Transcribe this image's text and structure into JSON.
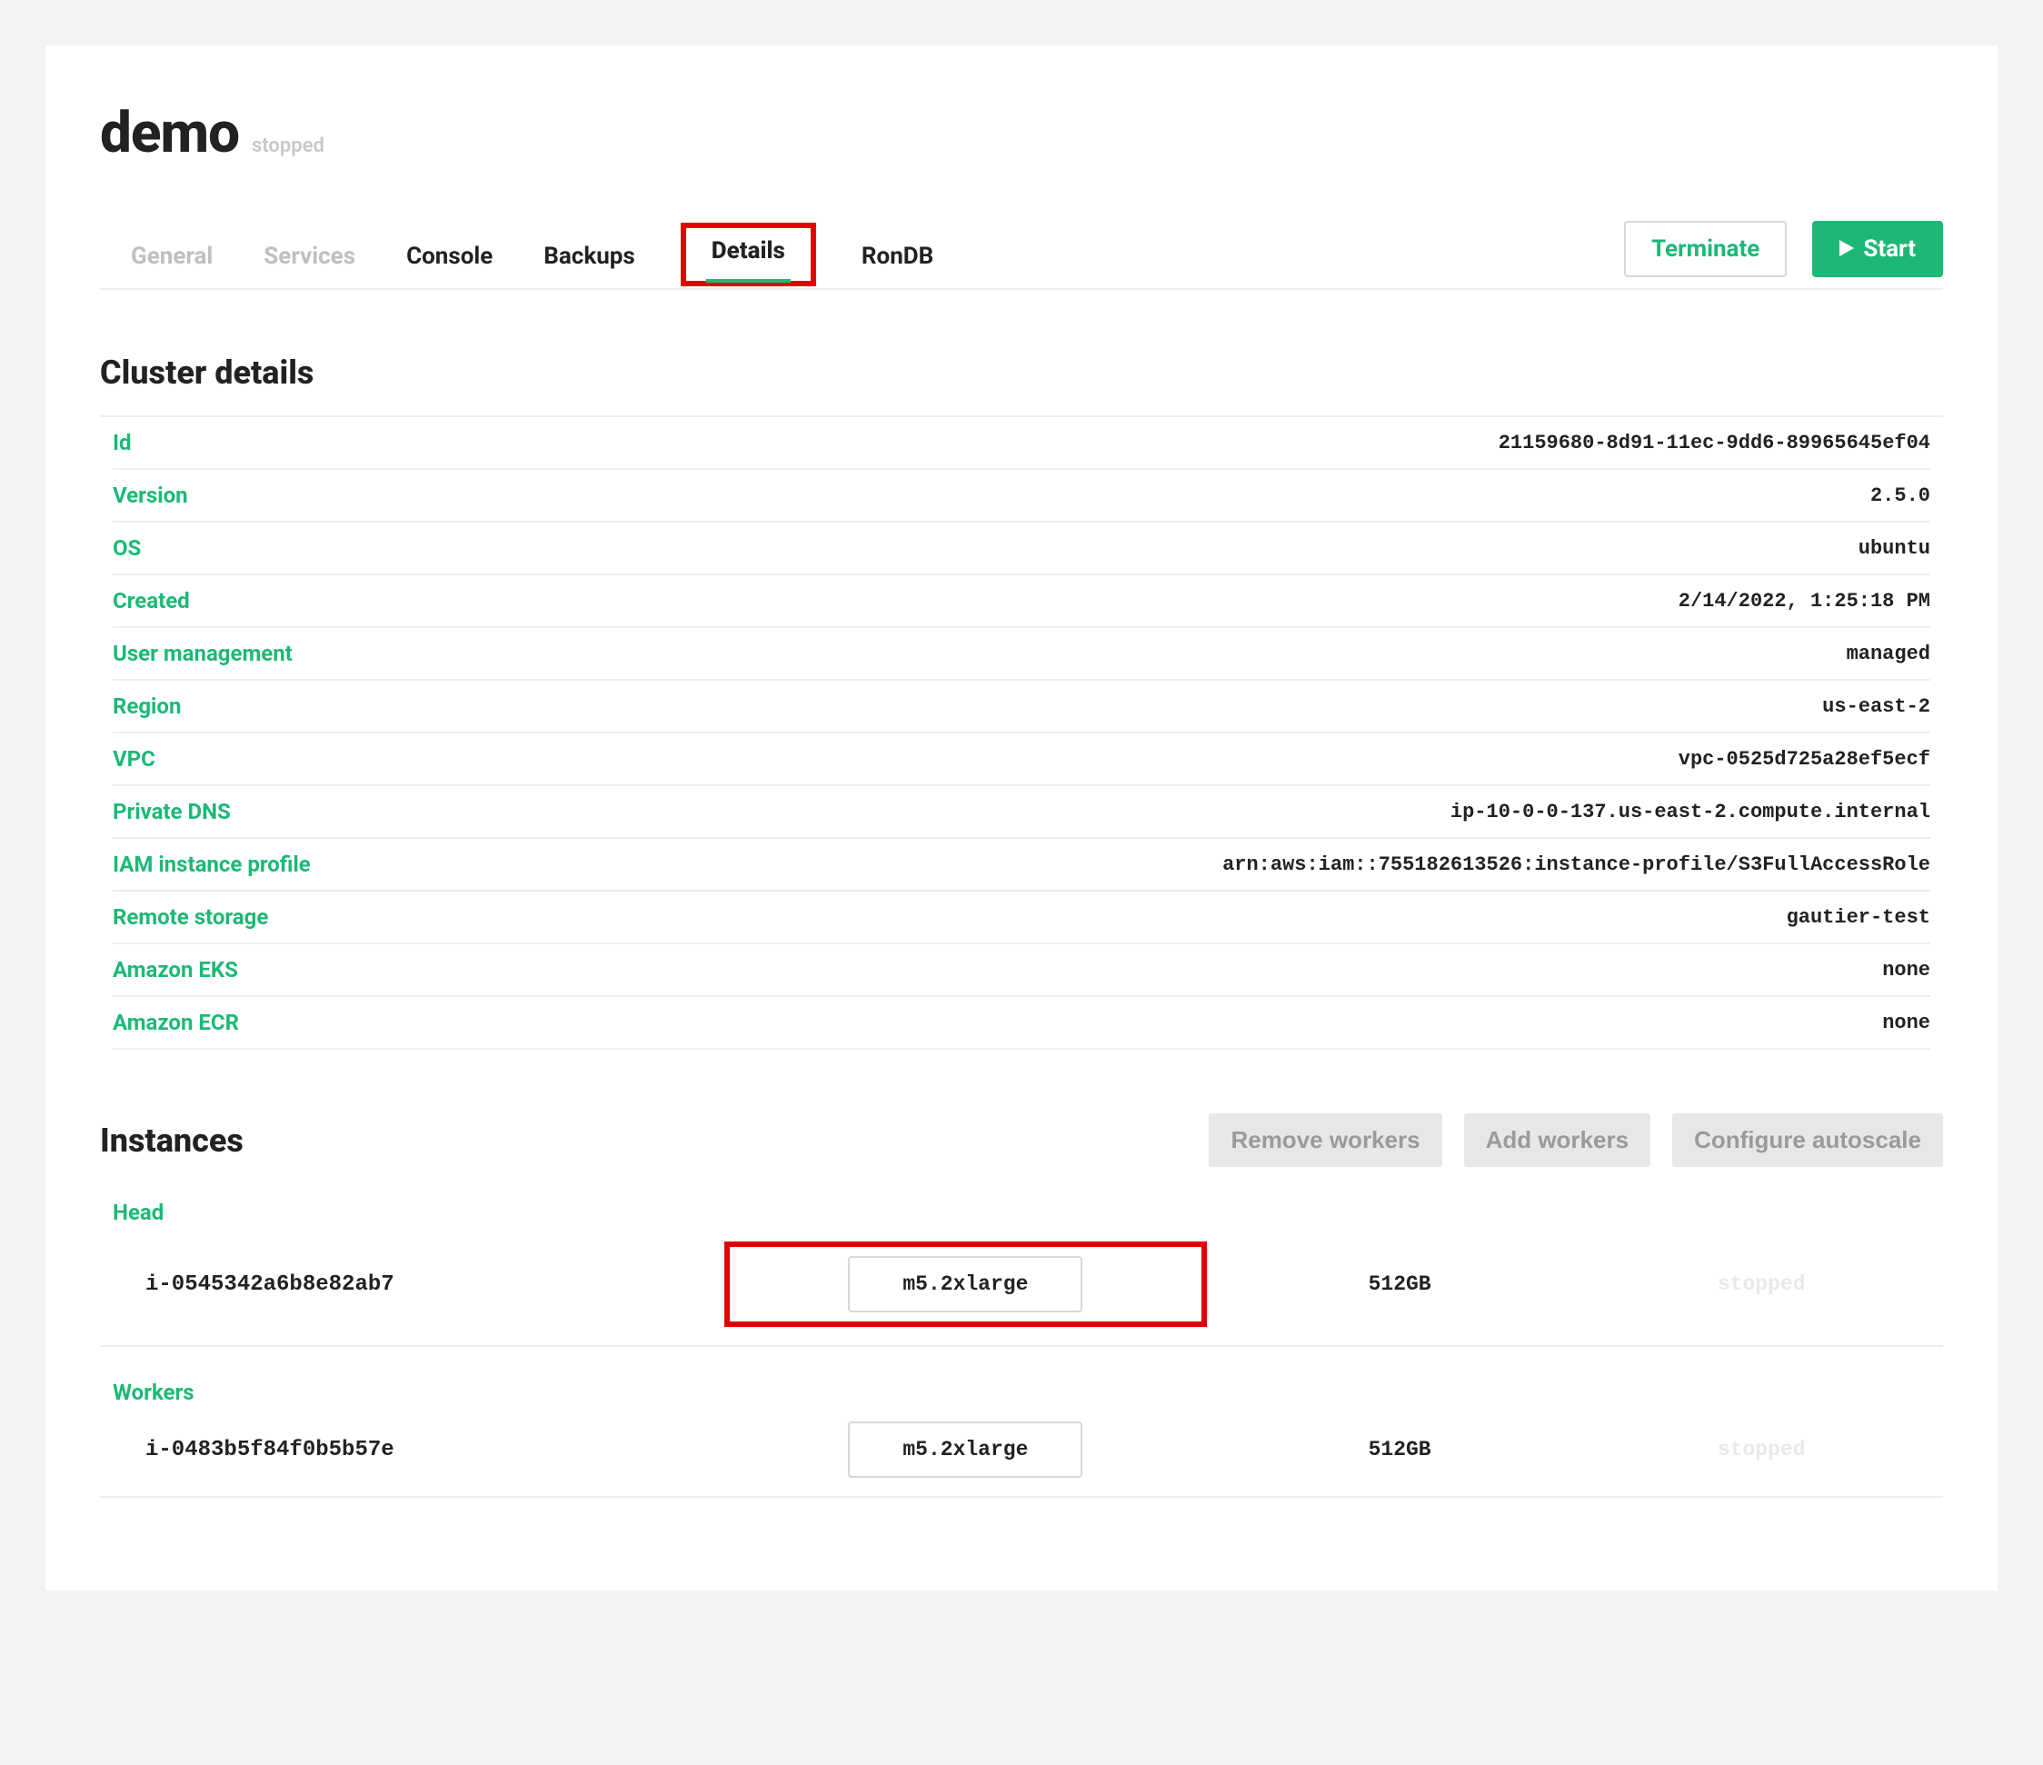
{
  "header": {
    "title": "demo",
    "status": "stopped"
  },
  "tabs": [
    {
      "label": "General",
      "disabled": true
    },
    {
      "label": "Services",
      "disabled": true
    },
    {
      "label": "Console"
    },
    {
      "label": "Backups"
    },
    {
      "label": "Details",
      "active": true,
      "highlight": true
    },
    {
      "label": "RonDB"
    }
  ],
  "actions": {
    "terminate": "Terminate",
    "start": "Start"
  },
  "details": {
    "title": "Cluster details",
    "rows": [
      {
        "key": "Id",
        "value": "21159680-8d91-11ec-9dd6-89965645ef04"
      },
      {
        "key": "Version",
        "value": "2.5.0"
      },
      {
        "key": "OS",
        "value": "ubuntu"
      },
      {
        "key": "Created",
        "value": "2/14/2022, 1:25:18 PM"
      },
      {
        "key": "User management",
        "value": "managed"
      },
      {
        "key": "Region",
        "value": "us-east-2"
      },
      {
        "key": "VPC",
        "value": "vpc-0525d725a28ef5ecf"
      },
      {
        "key": "Private DNS",
        "value": "ip-10-0-0-137.us-east-2.compute.internal"
      },
      {
        "key": "IAM instance profile",
        "value": "arn:aws:iam::755182613526:instance-profile/S3FullAccessRole"
      },
      {
        "key": "Remote storage",
        "value": "gautier-test"
      },
      {
        "key": "Amazon EKS",
        "value": "none"
      },
      {
        "key": "Amazon ECR",
        "value": "none"
      }
    ]
  },
  "instances": {
    "title": "Instances",
    "actions": {
      "remove": "Remove workers",
      "add": "Add workers",
      "autoscale": "Configure autoscale"
    },
    "groups": [
      {
        "label": "Head",
        "rows": [
          {
            "id": "i-0545342a6b8e82ab7",
            "type": "m5.2xlarge",
            "size": "512GB",
            "status": "stopped",
            "highlight": true
          }
        ]
      },
      {
        "label": "Workers",
        "rows": [
          {
            "id": "i-0483b5f84f0b5b57e",
            "type": "m5.2xlarge",
            "size": "512GB",
            "status": "stopped"
          }
        ]
      }
    ]
  }
}
